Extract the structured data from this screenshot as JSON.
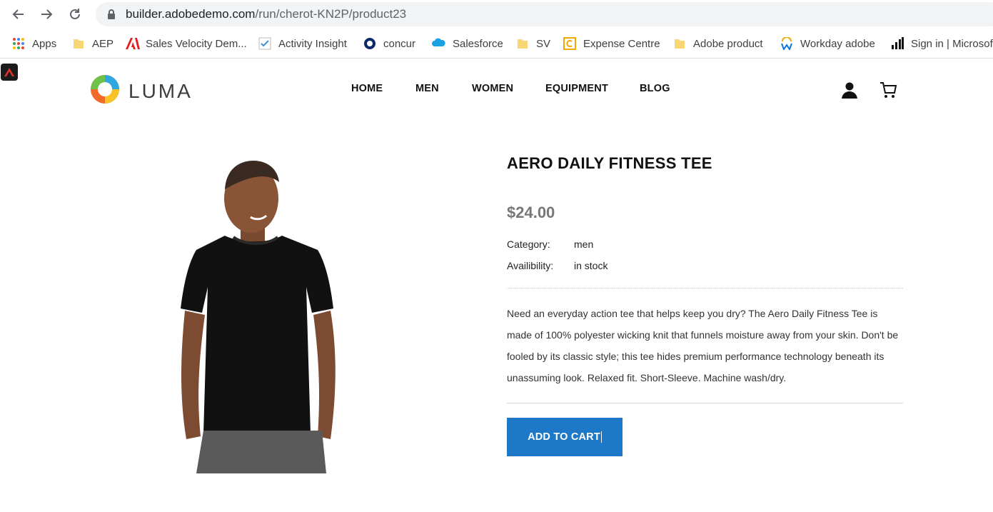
{
  "browser": {
    "url_host": "builder.adobedemo.com",
    "url_path": "/run/cherot-KN2P/product23",
    "bookmarks": [
      {
        "label": "Apps",
        "icon": "apps-grid-icon"
      },
      {
        "label": "AEP",
        "icon": "folder-icon"
      },
      {
        "label": "Sales Velocity Dem...",
        "icon": "adobe-icon"
      },
      {
        "label": "Activity Insight",
        "icon": "checkbox-icon"
      },
      {
        "label": "concur",
        "icon": "concur-icon"
      },
      {
        "label": "Salesforce",
        "icon": "salesforce-cloud-icon"
      },
      {
        "label": "SV",
        "icon": "folder-icon"
      },
      {
        "label": "Expense Centre",
        "icon": "expense-icon"
      },
      {
        "label": "Adobe product",
        "icon": "folder-icon"
      },
      {
        "label": "Workday adobe",
        "icon": "workday-icon"
      },
      {
        "label": "Sign in | Microsoft",
        "icon": "bar-chart-icon"
      }
    ]
  },
  "site": {
    "logo_text": "LUMA",
    "nav": [
      "HOME",
      "MEN",
      "WOMEN",
      "EQUIPMENT",
      "BLOG"
    ]
  },
  "product": {
    "title": "AERO DAILY FITNESS TEE",
    "price": "$24.00",
    "category_label": "Category:",
    "category_value": "men",
    "availability_label": "Availibility:",
    "availability_value": "in stock",
    "description": "Need an everyday action tee that helps keep you dry? The Aero Daily Fitness Tee is made of 100% polyester wicking knit that funnels moisture away from your skin. Don't be fooled by its classic style; this tee hides premium performance technology beneath its unassuming look. Relaxed fit. Short-Sleeve. Machine wash/dry.",
    "add_to_cart": "ADD TO CART"
  },
  "colors": {
    "accent": "#1e78c8",
    "price": "#777777"
  }
}
